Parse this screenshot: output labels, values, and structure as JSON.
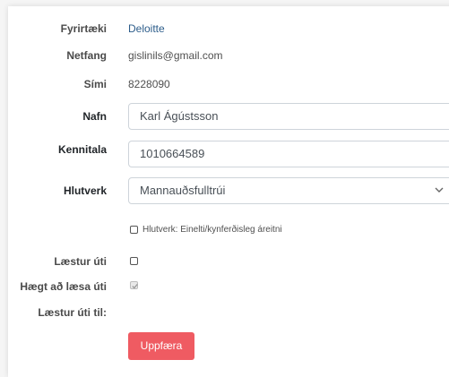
{
  "labels": {
    "company": "Fyrirtæki",
    "email": "Netfang",
    "phone": "Sími",
    "name": "Nafn",
    "ssn": "Kennitala",
    "role": "Hlutverk",
    "locked_out": "Læstur úti",
    "can_unlock": "Hægt að læsa úti",
    "locked_until": "Læstur úti til:"
  },
  "values": {
    "company": "Deloitte",
    "email": "gislinils@gmail.com",
    "phone": "8228090",
    "name": "Karl Ágústsson",
    "ssn": "1010664589",
    "role": "Mannauðsfulltrúi"
  },
  "checkboxes": {
    "role_bullying": {
      "label": "Hlutverk: Einelti/kynferðisleg áreitni",
      "checked": false
    },
    "locked_out": {
      "checked": false
    },
    "can_unlock": {
      "checked": true,
      "disabled": true
    }
  },
  "buttons": {
    "update": "Uppfæra"
  },
  "colors": {
    "button_bg": "#ef5b62",
    "link_text": "#2c5c8a"
  }
}
